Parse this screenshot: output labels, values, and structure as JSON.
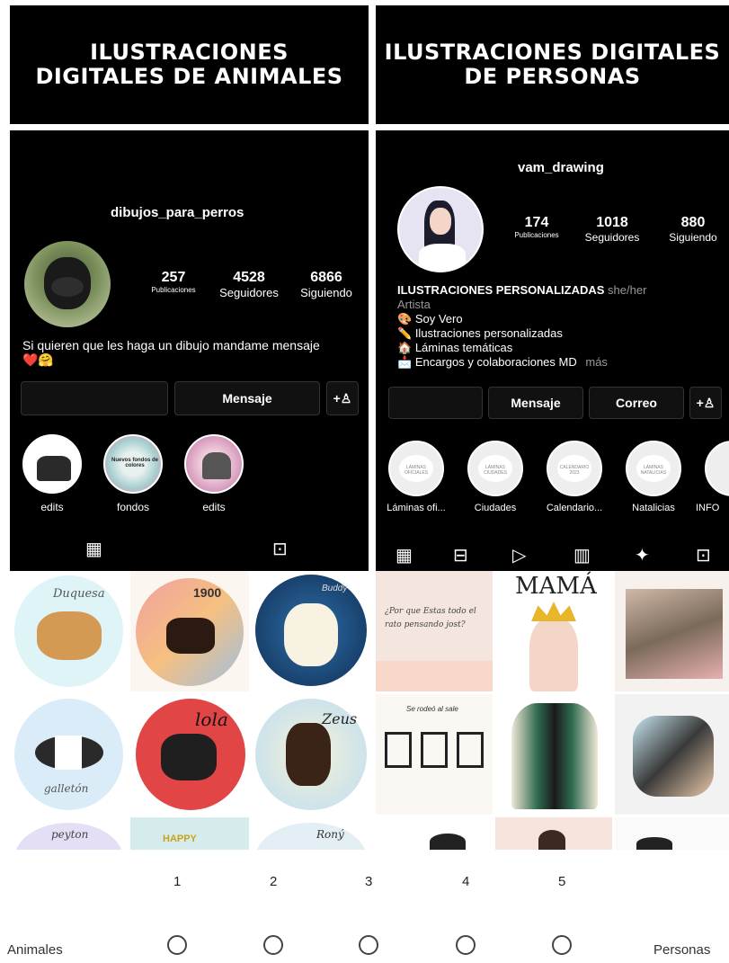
{
  "left": {
    "header": "ILUSTRACIONES DIGITALES DE ANIMALES",
    "username": "dibujos_para_perros",
    "stats": [
      {
        "n": "257",
        "l": "Publicaciones"
      },
      {
        "n": "4528",
        "l": "Seguidores"
      },
      {
        "n": "6866",
        "l": "Siguiendo"
      }
    ],
    "bio": "Si quieren que les haga un dibujo mandame mensaje",
    "bio_emoji": "❤️🤗",
    "message_btn": "Mensaje",
    "highlights": [
      "edits",
      "fondos",
      "edits"
    ],
    "highlight_texts": [
      "",
      "Nuevos fondos de colores"
    ],
    "grid_texts": [
      "Duquesa",
      "1900",
      "Buddy",
      "",
      "lola",
      "Zeus",
      "galletón",
      "",
      "",
      "peyton",
      "HAPPY",
      "Roný"
    ]
  },
  "right": {
    "header": "ILUSTRACIONES DIGITALES DE PERSONAS",
    "username": "vam_drawing",
    "stats": [
      {
        "n": "174",
        "l": "Publicaciones"
      },
      {
        "n": "1018",
        "l": "Seguidores"
      },
      {
        "n": "880",
        "l": "Siguiendo"
      }
    ],
    "bio_title": "ILUSTRACIONES PERSONALIZADAS",
    "pronoun": "she/her",
    "role": "Artista",
    "bio_lines": [
      "Soy Vero",
      "Ilustraciones personalizadas",
      "Láminas temáticas",
      "Encargos y colaboraciones MD"
    ],
    "more": "más",
    "buttons": [
      "Mensaje",
      "Correo"
    ],
    "highlights": [
      "Láminas ofi...",
      "Ciudades",
      "Calendario...",
      "Natalicias",
      "INFO"
    ],
    "highlight_inner": [
      "LÁMINAS OFICIALES",
      "LÁMINAS CIUDADES",
      "CALENDARIO 2023",
      "LÁMINAS NATALICIAS",
      ""
    ],
    "grid_texts": [
      "¿Por que Estas todo el rato pensando jost?",
      "MAMÁ",
      "Se rodeó al sale"
    ]
  },
  "scale": {
    "numbers": [
      "1",
      "2",
      "3",
      "4",
      "5"
    ],
    "left_label": "Animales",
    "right_label": "Personas"
  },
  "colors": {
    "accent_heart": "#e0245e"
  }
}
